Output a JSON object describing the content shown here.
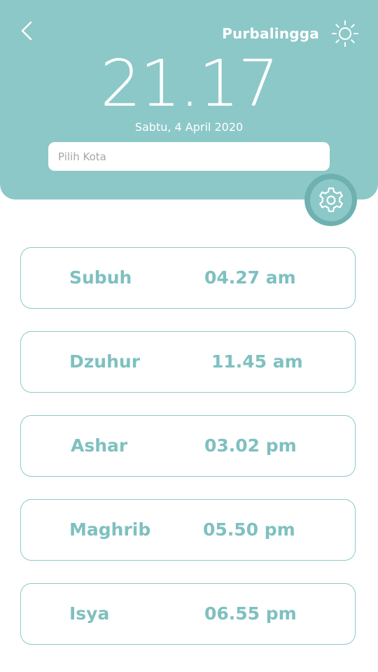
{
  "header": {
    "city": "Purbalingga",
    "time": "21.17",
    "date": "Sabtu, 4 April 2020",
    "search_placeholder": "Pilih Kota"
  },
  "icons": {
    "back": "chevron-left-icon",
    "theme": "sun-icon",
    "settings": "gear-icon"
  },
  "colors": {
    "accent": "#8cc8c8",
    "accent_dark": "#6fb1b1",
    "text_accent": "#7fc0c0"
  },
  "prayers": [
    {
      "name": "Subuh",
      "time": "04.27 am"
    },
    {
      "name": "Dzuhur",
      "time": "11.45 am"
    },
    {
      "name": "Ashar",
      "time": "03.02 pm"
    },
    {
      "name": "Maghrib",
      "time": "05.50 pm"
    },
    {
      "name": "Isya",
      "time": "06.55 pm"
    }
  ]
}
